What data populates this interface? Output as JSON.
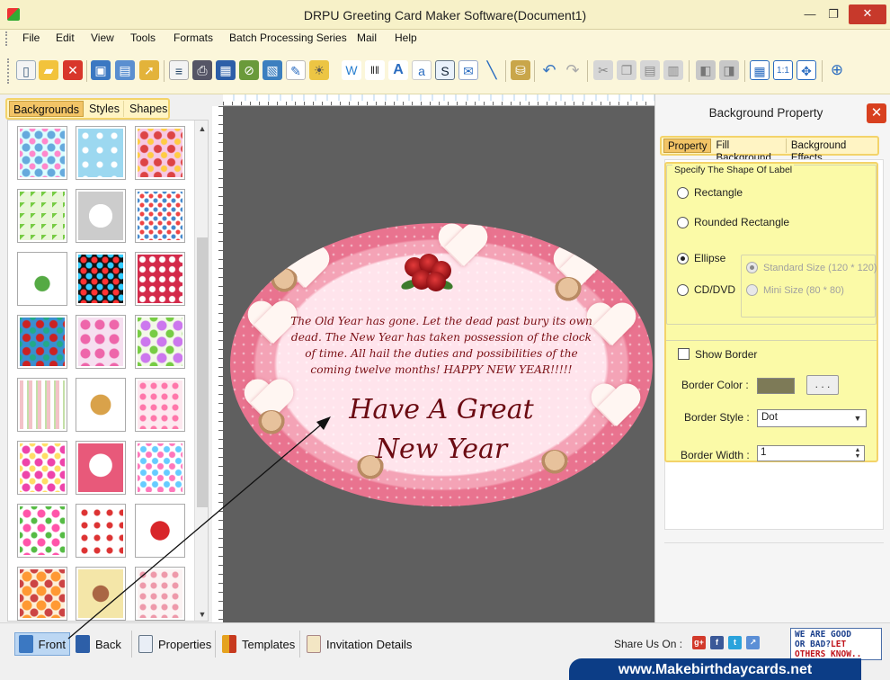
{
  "window": {
    "title": "DRPU Greeting Card Maker Software(Document1)",
    "min_glyph": "—",
    "max_glyph": "❐",
    "close_glyph": "✕"
  },
  "menu": [
    "File",
    "Edit",
    "View",
    "Tools",
    "Formats",
    "Batch Processing Series",
    "Mail",
    "Help"
  ],
  "toolbar": {
    "icons": [
      "new-icon",
      "open-icon",
      "close-doc-icon",
      "save-icon",
      "save-as-icon",
      "export-icon",
      "properties-icon",
      "print-icon",
      "print-preview-icon",
      "delete-icon",
      "image-icon",
      "pen-icon",
      "picture-icon",
      "watermark-icon",
      "barcode-icon",
      "text-icon",
      "word-art-icon",
      "signature-icon",
      "email-icon",
      "line-icon",
      "database-icon",
      "undo-icon",
      "redo-icon",
      "cut-icon",
      "copy-icon",
      "paste-icon",
      "paste-special-icon",
      "bring-front-icon",
      "send-back-icon",
      "grid-icon",
      "actual-size-icon",
      "fit-window-icon",
      "zoom-icon"
    ]
  },
  "left_panel": {
    "tabs": [
      "Backgrounds",
      "Styles",
      "Shapes"
    ],
    "active_tab": "Backgrounds",
    "up_arrow": "▲",
    "down_arrow": "▼",
    "thumbnail_count": 24
  },
  "card": {
    "verse": "The Old Year has gone. Let the dead past bury its own dead. The New Year has taken possession of the clock of time. All hail the duties and possibilities of the coming twelve months! HAPPY NEW YEAR!!!!!",
    "greeting_line1": "Have A Great",
    "greeting_line2": "New Year",
    "text_color": "#7a0f14",
    "border_color": "#e9738f"
  },
  "right_panel": {
    "title": "Background Property",
    "close_glyph": "✕",
    "tabs": [
      "Property",
      "Fill Background",
      "Background Effects"
    ],
    "active_tab": "Property",
    "shape_group_label": "Specify The Shape Of Label",
    "shapes": {
      "rectangle": "Rectangle",
      "rounded_rectangle": "Rounded Rectangle",
      "ellipse": "Ellipse",
      "cd_dvd": "CD/DVD"
    },
    "selected_shape": "Ellipse",
    "sizes": {
      "standard": "Standard Size (120 * 120)",
      "mini": "Mini Size (80 * 80)"
    },
    "selected_size": "Standard Size (120 * 120)",
    "show_border_label": "Show Border",
    "show_border_checked": false,
    "border_color_label": "Border Color :",
    "border_color_value": "#7d7a57",
    "border_color_button": ". . .",
    "border_style_label": "Border Style :",
    "border_style_value": "Dot",
    "border_width_label": "Border Width :",
    "border_width_value": "1"
  },
  "bottom_bar": {
    "buttons": [
      "Front",
      "Back",
      "Properties",
      "Templates",
      "Invitation Details"
    ],
    "active_button": "Front",
    "share_label": "Share Us On :",
    "social": [
      "google-plus-icon",
      "facebook-icon",
      "twitter-icon",
      "share-icon"
    ],
    "feedback_line1": "WE ARE GOOD",
    "feedback_line2": "OR BAD?",
    "feedback_line2_red": "LET",
    "feedback_line3": "OTHERS KNOW..",
    "website": "www.Makebirthdaycards.net"
  }
}
